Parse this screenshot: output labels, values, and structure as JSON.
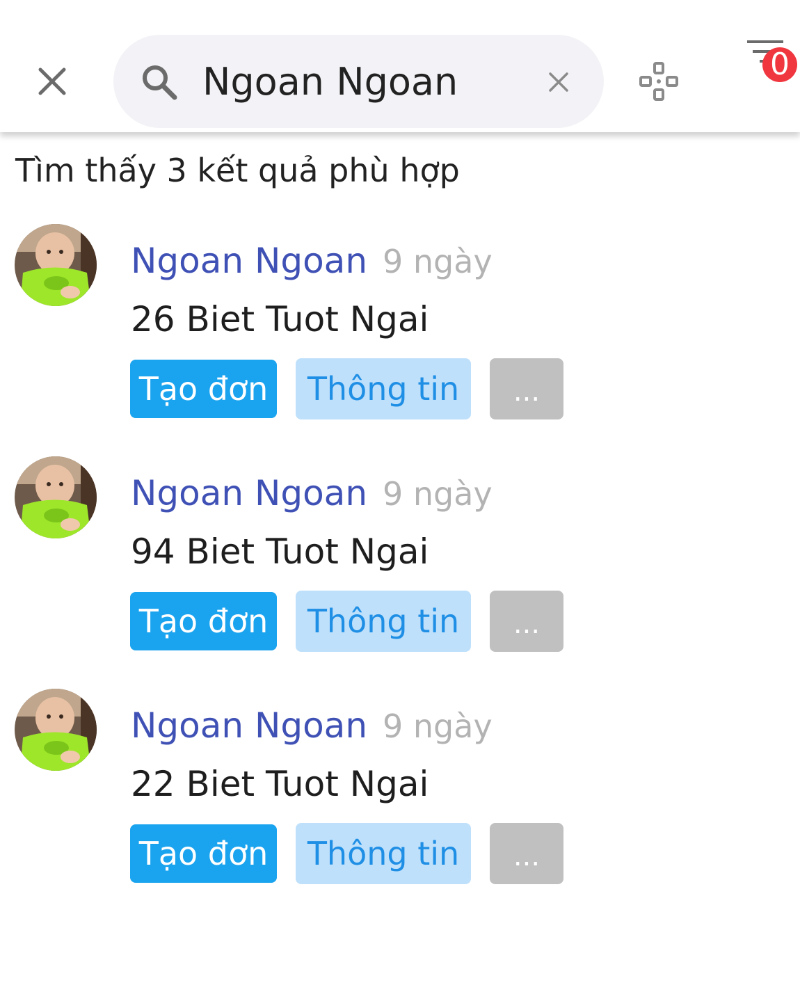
{
  "header": {
    "close_icon": "close-icon",
    "search": {
      "value": "Ngoan Ngoan",
      "icon": "search-icon",
      "clear_icon": "clear-icon"
    },
    "game_icon": "gamepad-icon",
    "filter": {
      "icon": "filter-icon",
      "badge": "0"
    }
  },
  "colors": {
    "name": "#3f51b5",
    "create_button": "#1aa3ee",
    "info_button_bg": "#bfe0fb",
    "info_button_text": "#1f8fe5",
    "more_button": "#c0c0c0",
    "badge": "#f0363f"
  },
  "results": {
    "summary": "Tìm thấy 3 kết quả phù hợp",
    "items": [
      {
        "name": "Ngoan Ngoan",
        "time": "9 ngày",
        "address": "26 Biet Tuot Ngai",
        "create_label": "Tạo đơn",
        "info_label": "Thông tin",
        "more_label": "..."
      },
      {
        "name": "Ngoan Ngoan",
        "time": "9 ngày",
        "address": "94 Biet Tuot Ngai",
        "create_label": "Tạo đơn",
        "info_label": "Thông tin",
        "more_label": "..."
      },
      {
        "name": "Ngoan Ngoan",
        "time": "9 ngày",
        "address": "22 Biet Tuot Ngai",
        "create_label": "Tạo đơn",
        "info_label": "Thông tin",
        "more_label": "..."
      }
    ]
  }
}
